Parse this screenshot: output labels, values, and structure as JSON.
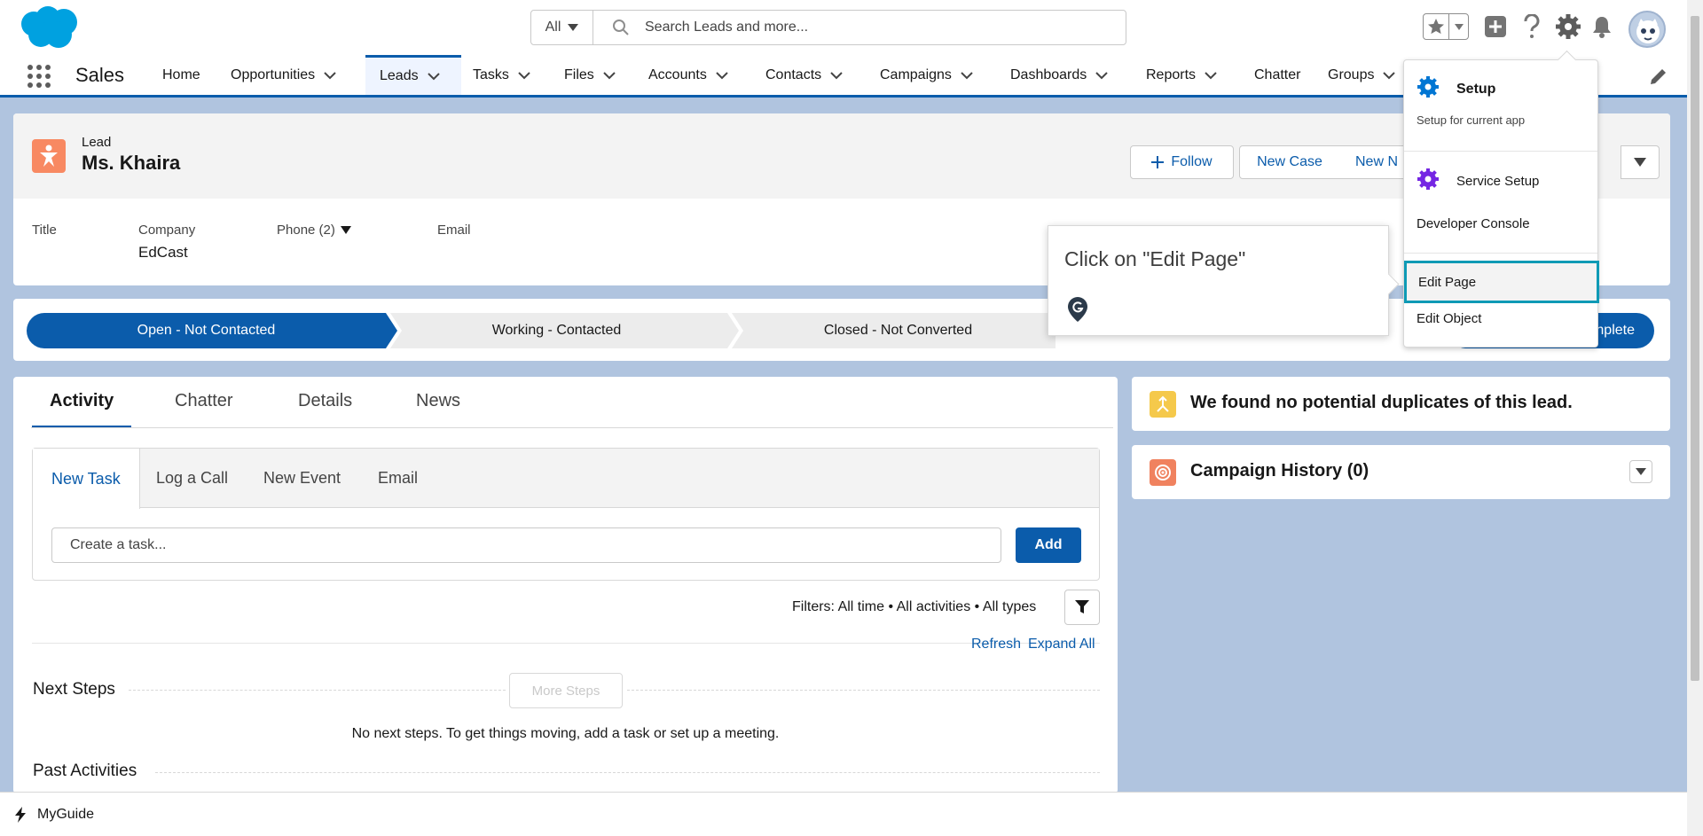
{
  "header": {
    "search_scope": "All",
    "search_placeholder": "Search Leads and more..."
  },
  "nav": {
    "app_name": "Sales",
    "items": [
      {
        "label": "Home",
        "has_menu": false
      },
      {
        "label": "Opportunities",
        "has_menu": true
      },
      {
        "label": "Leads",
        "has_menu": true,
        "active": true
      },
      {
        "label": "Tasks",
        "has_menu": true
      },
      {
        "label": "Files",
        "has_menu": true
      },
      {
        "label": "Accounts",
        "has_menu": true
      },
      {
        "label": "Contacts",
        "has_menu": true
      },
      {
        "label": "Campaigns",
        "has_menu": true
      },
      {
        "label": "Dashboards",
        "has_menu": true
      },
      {
        "label": "Reports",
        "has_menu": true
      },
      {
        "label": "Chatter",
        "has_menu": false
      },
      {
        "label": "Groups",
        "has_menu": true
      }
    ]
  },
  "record": {
    "object_type": "Lead",
    "name": "Ms. Khaira",
    "buttons": {
      "follow": "Follow",
      "new_case": "New Case",
      "new_note": "New N"
    },
    "fields": {
      "title_label": "Title",
      "title_value": "",
      "company_label": "Company",
      "company_value": "EdCast",
      "phone_label": "Phone (2)",
      "email_label": "Email"
    }
  },
  "path": {
    "stages": [
      "Open - Not Contacted",
      "Working - Contacted",
      "Closed - Not Converted"
    ],
    "current_stage": 0,
    "complete_label": "nplete"
  },
  "activity": {
    "tabs": [
      "Activity",
      "Chatter",
      "Details",
      "News"
    ],
    "composer_tabs": [
      "New Task",
      "Log a Call",
      "New Event",
      "Email"
    ],
    "task_placeholder": "Create a task...",
    "add_label": "Add",
    "filters": "Filters: All time • All activities • All types",
    "refresh": "Refresh",
    "expand_all": "Expand All",
    "next_steps": "Next Steps",
    "more_steps": "More Steps",
    "no_steps": "No next steps. To get things moving, add a task or set up a meeting.",
    "past_activities": "Past Activities"
  },
  "side": {
    "duplicates": "We found no potential duplicates of this lead.",
    "campaign_history": "Campaign History (0)"
  },
  "setup_menu": {
    "setup_title": "Setup",
    "setup_desc": "Setup for current app",
    "service_setup": "Service Setup",
    "developer_console": "Developer Console",
    "edit_page": "Edit Page",
    "edit_object": "Edit Object"
  },
  "guide": {
    "text": "Click on \"Edit Page\""
  },
  "bottom": {
    "label": "MyGuide"
  },
  "colors": {
    "brand": "#0b5cab",
    "lead_icon": "#f88962",
    "highlight": "#0e9ab5",
    "background": "#b0c4df"
  }
}
